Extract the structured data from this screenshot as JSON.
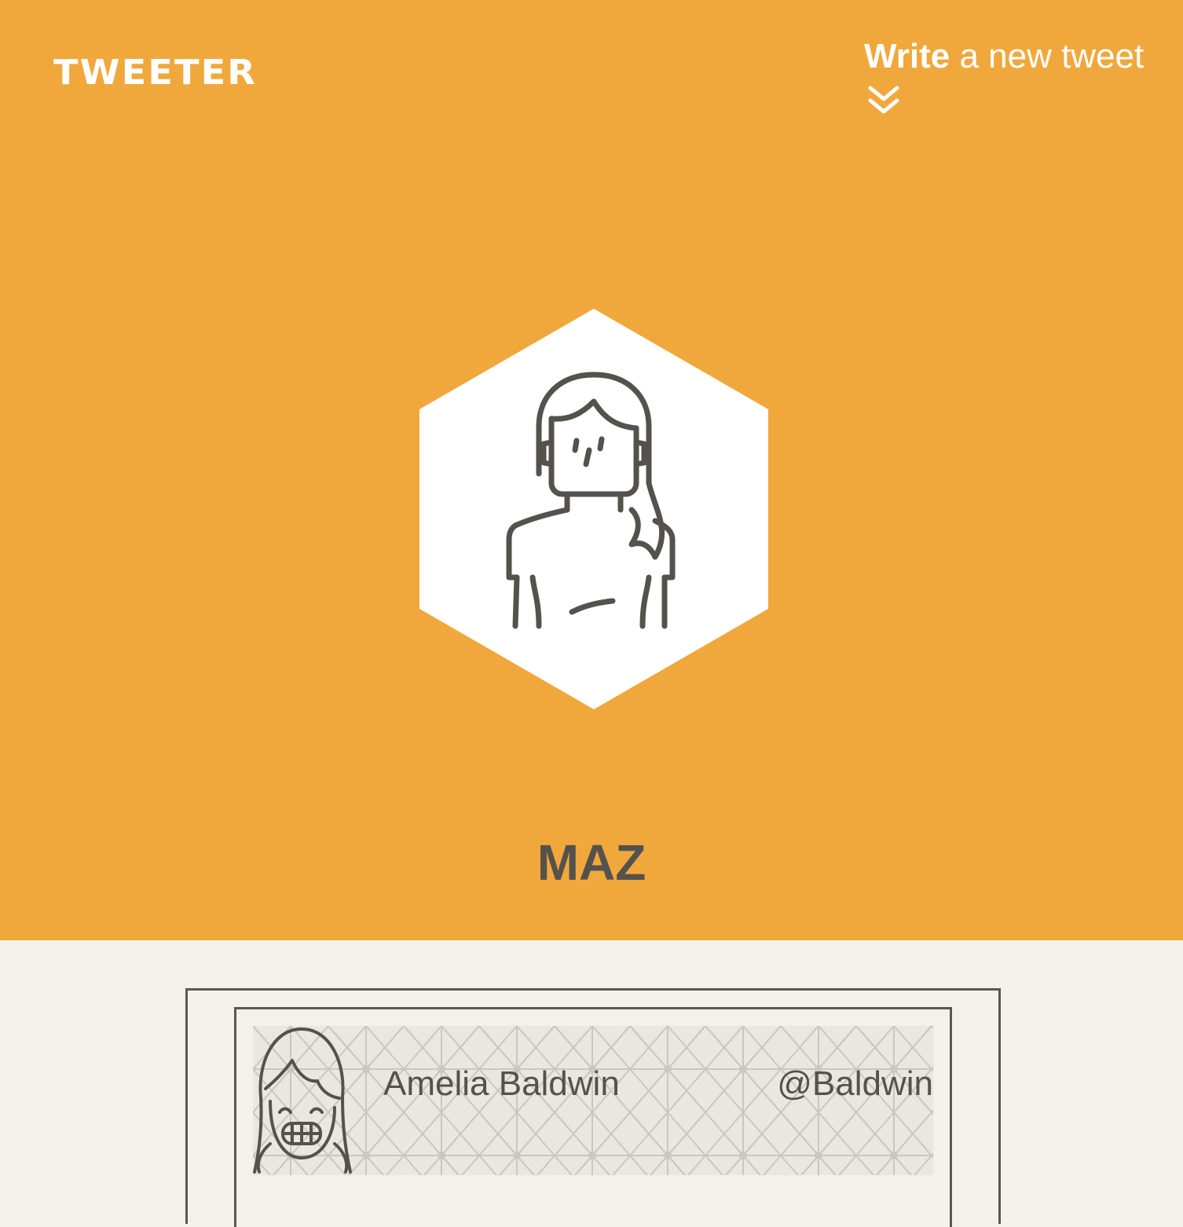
{
  "header": {
    "logo": "TWEETER",
    "write_link": {
      "strong": "Write",
      "rest": " a new tweet",
      "icon": "double-chevron-down-icon"
    }
  },
  "profile": {
    "avatar_icon": "woman-avatar-icon",
    "name": "MAZ"
  },
  "tweet": {
    "avatar_icon": "smiling-girl-avatar-icon",
    "name": "Amelia Baldwin",
    "handle": "@Baldwin"
  },
  "colors": {
    "hero_background": "#F0A83C",
    "page_background": "#F4F1EC",
    "text_dark": "#55524D",
    "white": "#FFFFFF"
  }
}
